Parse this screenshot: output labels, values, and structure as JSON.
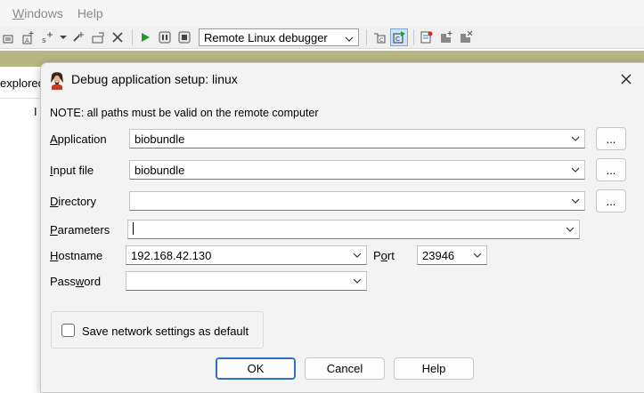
{
  "menubar": {
    "items": [
      {
        "label": "Windows"
      },
      {
        "label": "Help"
      }
    ]
  },
  "toolbar": {
    "debugger_select": "Remote Linux debugger"
  },
  "background": {
    "explorer_label": "explored",
    "column_letter": "I"
  },
  "dialog": {
    "title": "Debug application setup: linux",
    "note": "NOTE: all paths must be valid on the remote computer",
    "application": {
      "label": "Application",
      "value": "biobundle"
    },
    "input_file": {
      "label": "Input file",
      "value": "biobundle"
    },
    "directory": {
      "label": "Directory",
      "value": ""
    },
    "parameters": {
      "label": "Parameters",
      "value": ""
    },
    "hostname": {
      "label": "Hostname",
      "value": "192.168.42.130"
    },
    "port": {
      "label": "Port",
      "value": "23946"
    },
    "password": {
      "label": "Password",
      "value": ""
    },
    "browse_label": "...",
    "save_checkbox": {
      "label": "Save network settings as default",
      "checked": false
    },
    "buttons": {
      "ok": "OK",
      "cancel": "Cancel",
      "help": "Help"
    }
  },
  "colors": {
    "olive_band": "#b6b680",
    "primary_border": "#2e6fc4",
    "dialog_bg": "#f3f3f3"
  }
}
